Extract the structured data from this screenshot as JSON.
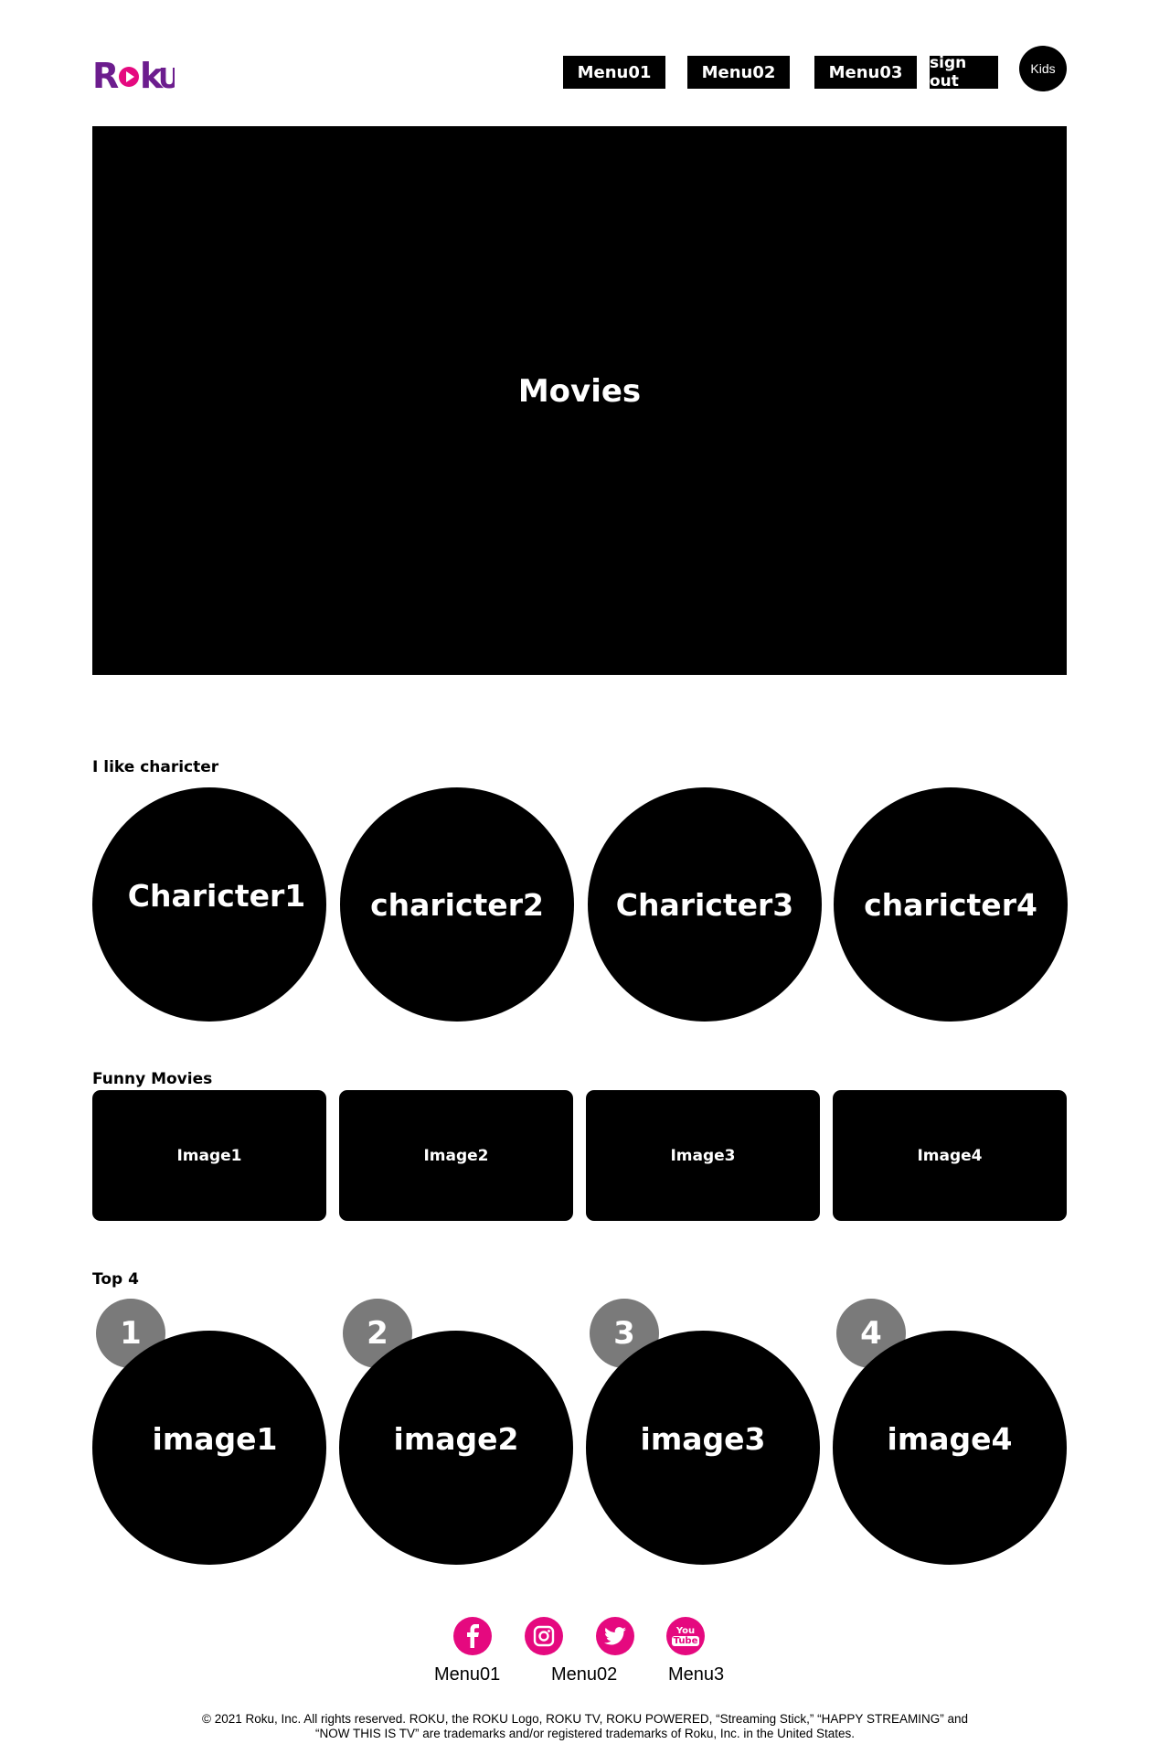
{
  "header": {
    "logo_text": "Roku",
    "brand_colors": {
      "purple": "#6c1d8e",
      "pink": "#e5097f"
    },
    "nav": [
      "Menu01",
      "Menu02",
      "Menu03",
      "sign out"
    ],
    "kids_label": "Kids"
  },
  "hero": {
    "label": "Movies"
  },
  "characters": {
    "title": "I like charicter",
    "items": [
      "Charicter1",
      "charicter2",
      "Charicter3",
      "charicter4"
    ]
  },
  "funny": {
    "title": "Funny Movies",
    "items": [
      "Image1",
      "Image2",
      "Image3",
      "Image4"
    ]
  },
  "top4": {
    "title": "Top 4",
    "items": [
      {
        "rank": "1",
        "label": "image1"
      },
      {
        "rank": "2",
        "label": "image2"
      },
      {
        "rank": "3",
        "label": "image3"
      },
      {
        "rank": "4",
        "label": "image4"
      }
    ]
  },
  "footer": {
    "social_icons": [
      "facebook-icon",
      "instagram-icon",
      "twitter-icon",
      "youtube-icon"
    ],
    "youtube_text": [
      "You",
      "Tube"
    ],
    "social_color": "#e5097f",
    "links": [
      "Menu01",
      "Menu02",
      "Menu3"
    ],
    "copyright_line1": "© 2021 Roku, Inc. All rights reserved. ROKU, the ROKU Logo, ROKU TV, ROKU POWERED, “Streaming Stick,” “HAPPY STREAMING” and",
    "copyright_line2": "“NOW THIS IS TV” are trademarks and/or registered trademarks of Roku, Inc. in the United States."
  }
}
